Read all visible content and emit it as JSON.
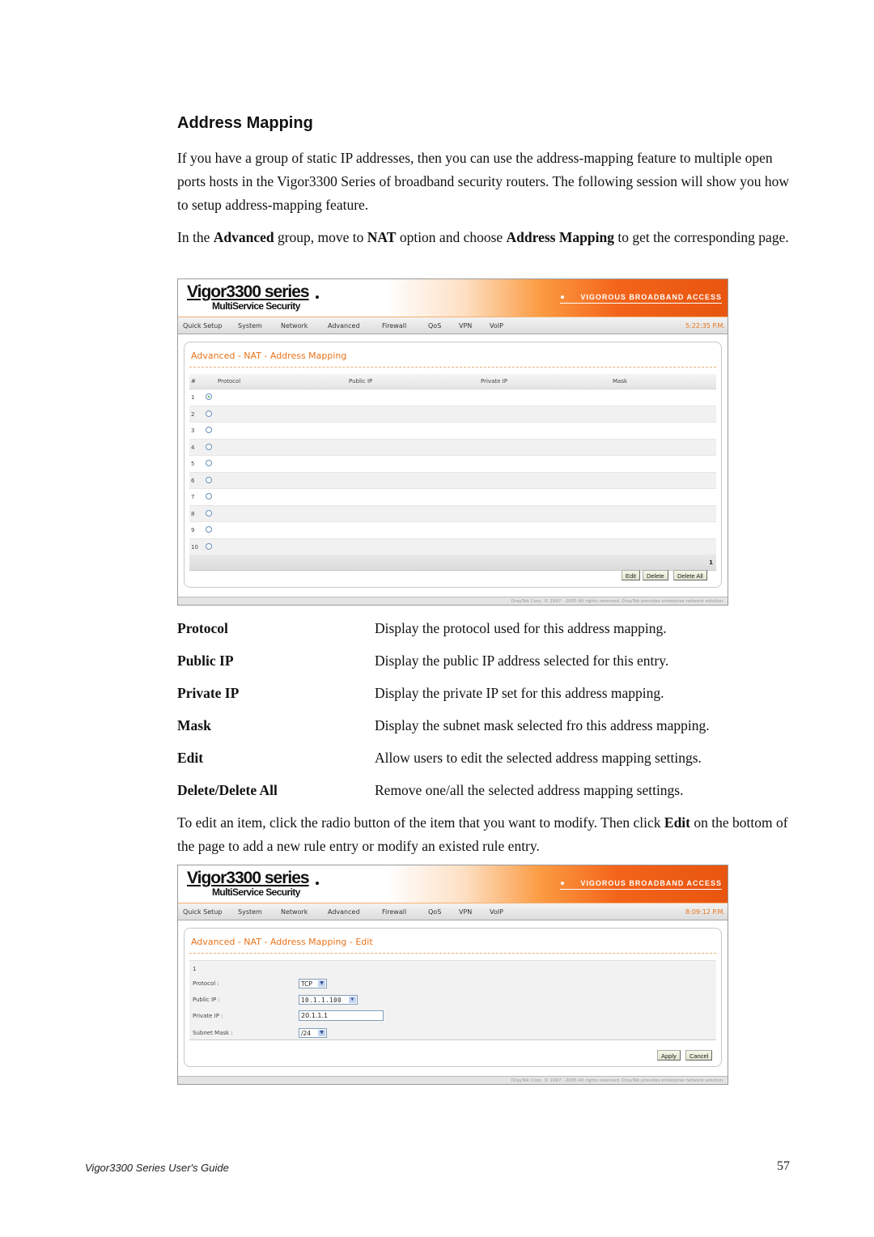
{
  "section_title": "Address Mapping",
  "intro_paragraph": "If you have a group of static IP addresses, then you can use the address-mapping feature to multiple open ports hosts in the Vigor3300 Series of broadband security routers. The following session will show you how to setup address-mapping feature.",
  "nav_paragraph": {
    "t1": "In the ",
    "b1": "Advanced",
    "t2": " group, move to ",
    "b2": "NAT",
    "t3": " option and choose ",
    "b3": "Address Mapping",
    "t4": " to get the corresponding page."
  },
  "router_ui": {
    "logo_main": "Vigor3300 series",
    "logo_sub": "MultiService Security",
    "tagline": "VIGOROUS BROADBAND ACCESS",
    "menu": [
      "Quick Setup",
      "System",
      "Network",
      "Advanced",
      "Firewall",
      "QoS",
      "VPN",
      "VoIP"
    ],
    "copyright": "DrayTek Corp. © 1997 - 2005 All rights reserved. DrayTek provides enterprise network solution."
  },
  "screenshot1": {
    "clock": "5:22:35 P.M.",
    "panel_title": "Advanced - NAT - Address Mapping",
    "columns": [
      "#",
      "Protocol",
      "Public IP",
      "Private IP",
      "Mask"
    ],
    "rows": [
      {
        "num": "1",
        "selected": true
      },
      {
        "num": "2",
        "selected": false
      },
      {
        "num": "3",
        "selected": false
      },
      {
        "num": "4",
        "selected": false
      },
      {
        "num": "5",
        "selected": false
      },
      {
        "num": "6",
        "selected": false
      },
      {
        "num": "7",
        "selected": false
      },
      {
        "num": "8",
        "selected": false
      },
      {
        "num": "9",
        "selected": false
      },
      {
        "num": "10",
        "selected": false
      }
    ],
    "page_number": "1",
    "buttons": {
      "edit": "Edit",
      "delete": "Delete",
      "delete_all": "Delete All"
    }
  },
  "definitions": [
    {
      "term": "Protocol",
      "desc": "Display the protocol used for this address mapping."
    },
    {
      "term": "Public IP",
      "desc": "Display the public IP address selected for this entry."
    },
    {
      "term": "Private IP",
      "desc": "Display the private IP set for this address mapping."
    },
    {
      "term": "Mask",
      "desc": "Display the subnet mask selected fro this address mapping."
    },
    {
      "term": "Edit",
      "desc": "Allow users to edit the selected address mapping settings."
    },
    {
      "term": "Delete/Delete All",
      "desc": "Remove one/all the selected address mapping settings."
    }
  ],
  "edit_paragraph": {
    "t1": "To edit an item, click the radio button of the item that you want to modify. Then click ",
    "b1": "Edit",
    "t2": " on the bottom of the page to add a new rule entry or modify an existed rule entry."
  },
  "screenshot2": {
    "clock": "8:09:12 P.M.",
    "panel_title": "Advanced - NAT - Address Mapping - Edit",
    "entry_index": "1",
    "fields": {
      "protocol_label": "Protocol :",
      "protocol_value": "TCP",
      "public_ip_label": "Public IP :",
      "public_ip_value": "10.1.1.100",
      "private_ip_label": "Private IP :",
      "private_ip_value": "20.1.1.1",
      "subnet_mask_label": "Subnet Mask :",
      "subnet_mask_value": "/24"
    },
    "buttons": {
      "apply": "Apply",
      "cancel": "Cancel"
    }
  },
  "footer": {
    "guide_title": "Vigor3300 Series User's Guide",
    "page_number": "57"
  },
  "colors": {
    "accent_orange": "#e8731a",
    "radio_selected": "#2a9a2a"
  }
}
